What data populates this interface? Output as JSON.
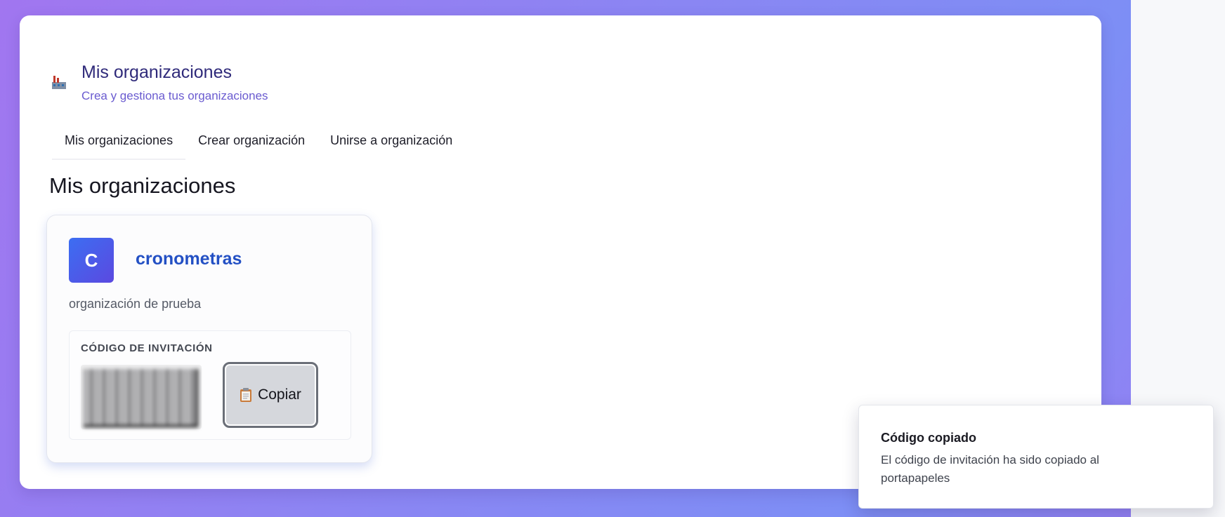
{
  "header": {
    "icon": "factory-icon",
    "title": "Mis organizaciones",
    "subtitle": "Crea y gestiona tus organizaciones"
  },
  "tabs": [
    {
      "label": "Mis organizaciones",
      "active": true
    },
    {
      "label": "Crear organización",
      "active": false
    },
    {
      "label": "Unirse a organización",
      "active": false
    }
  ],
  "section_title": "Mis organizaciones",
  "organization": {
    "avatar_letter": "C",
    "name": "cronometras",
    "description": "organización de prueba",
    "invite_label": "CÓDIGO DE INVITACIÓN",
    "copy_button": {
      "icon": "clipboard-icon",
      "label": "Copiar"
    }
  },
  "toast": {
    "title": "Código copiado",
    "message": "El código de invitación ha sido copiado al portapapeles"
  },
  "colors": {
    "accent": "#2350c4",
    "avatar_gradient": [
      "#3c6ef2",
      "#5b49e0"
    ],
    "title": "#2f2a7a"
  }
}
